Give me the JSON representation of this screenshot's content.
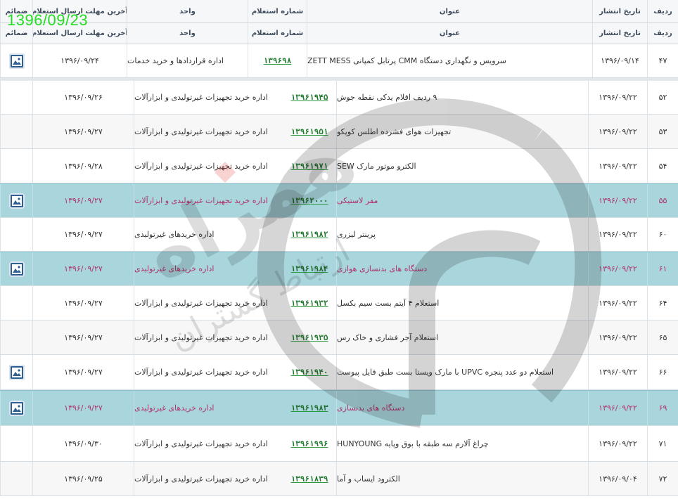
{
  "overlay_date": "1396/09/23",
  "headers": {
    "row_no": "ردیف",
    "pub_date": "تاریخ انتشار",
    "title": "عنوان",
    "inquiry_no": "شماره استعلام",
    "unit": "واحد",
    "deadline": "آخرین مهلت ارسال استعلام",
    "attachments": "ضمائم"
  },
  "top_row": {
    "no": "۴۷",
    "date": "۱۳۹۶/۰۹/۱۴",
    "title": "سرویس و نگهداری دستگاه CMM پرتابل کمپانی ZETT MESS",
    "inquiry": "۱۳۹۶۹۸",
    "unit": "اداره قراردادها و خرید خدمات",
    "deadline": "۱۳۹۶/۰۹/۲۴",
    "icon": "image-file-icon"
  },
  "rows": [
    {
      "no": "۵۲",
      "date": "۱۳۹۶/۰۹/۲۲",
      "title": "۹ ردیف اقلام یدکی نقطه جوش",
      "inquiry": "۱۳۹۶۱۹۴۵",
      "unit": "اداره خرید تجهیزات غیرتولیدی و ابزارآلات",
      "deadline": "۱۳۹۶/۰۹/۲۶",
      "style": "plain",
      "icon": false
    },
    {
      "no": "۵۳",
      "date": "۱۳۹۶/۰۹/۲۲",
      "title": "تجهیزات هوای فشرده اطلس کوپکو",
      "inquiry": "۱۳۹۶۱۹۵۱",
      "unit": "اداره خرید تجهیزات غیرتولیدی و ابزارآلات",
      "deadline": "۱۳۹۶/۰۹/۲۷",
      "style": "alt",
      "icon": false
    },
    {
      "no": "۵۴",
      "date": "۱۳۹۶/۰۹/۲۲",
      "title": "الکترو موتور مارک SEW",
      "inquiry": "۱۳۹۶۱۹۷۱",
      "unit": "اداره خرید تجهیزات غیرتولیدی و ابزارآلات",
      "deadline": "۱۳۹۶/۰۹/۲۸",
      "style": "plain",
      "icon": false
    },
    {
      "no": "۵۵",
      "date": "۱۳۹۶/۰۹/۲۲",
      "title": "مفر لاستیکی",
      "inquiry": "۱۳۹۶۲۰۰۰",
      "unit": "اداره خرید تجهیزات غیرتولیدی و ابزارآلات",
      "deadline": "۱۳۹۶/۰۹/۲۷",
      "style": "hl",
      "icon": true
    },
    {
      "no": "۶۰",
      "date": "۱۳۹۶/۰۹/۲۲",
      "title": "پرینتر لیزری",
      "inquiry": "۱۳۹۶۱۹۸۲",
      "unit": "اداره خریدهای غیرتولیدی",
      "deadline": "۱۳۹۶/۰۹/۲۷",
      "style": "plain",
      "icon": false
    },
    {
      "no": "۶۱",
      "date": "۱۳۹۶/۰۹/۲۲",
      "title": "دستگاه های بدنسازی هوازی",
      "inquiry": "۱۳۹۶۱۹۸۴",
      "unit": "اداره خریدهای غیرتولیدی",
      "deadline": "۱۳۹۶/۰۹/۲۷",
      "style": "hl",
      "icon": true
    },
    {
      "no": "۶۴",
      "date": "۱۳۹۶/۰۹/۲۲",
      "title": "استعلام ۴ آیتم بست سیم بکسل",
      "inquiry": "۱۳۹۶۱۹۳۲",
      "unit": "اداره خرید تجهیزات غیرتولیدی و ابزارآلات",
      "deadline": "۱۳۹۶/۰۹/۲۷",
      "style": "plain",
      "icon": false
    },
    {
      "no": "۶۵",
      "date": "۱۳۹۶/۰۹/۲۲",
      "title": "استعلام آجر فشاری و خاک رس",
      "inquiry": "۱۳۹۶۱۹۳۵",
      "unit": "اداره خرید تجهیزات غیرتولیدی و ابزارآلات",
      "deadline": "۱۳۹۶/۰۹/۲۷",
      "style": "alt",
      "icon": false
    },
    {
      "no": "۶۶",
      "date": "۱۳۹۶/۰۹/۲۲",
      "title": "استعلام دو عدد پنجره UPVC با مارک ویستا بست طبق فایل پیوست",
      "inquiry": "۱۳۹۶۱۹۴۰",
      "unit": "اداره خرید تجهیزات غیرتولیدی و ابزارآلات",
      "deadline": "۱۳۹۶/۰۹/۲۷",
      "style": "plain",
      "icon": true
    },
    {
      "no": "۶۹",
      "date": "۱۳۹۶/۰۹/۲۲",
      "title": "دستگاه های بدنسازی",
      "inquiry": "۱۳۹۶۱۹۸۳",
      "unit": "اداره خریدهای غیرتولیدی",
      "deadline": "۱۳۹۶/۰۹/۲۷",
      "style": "hl",
      "icon": true
    },
    {
      "no": "۷۱",
      "date": "۱۳۹۶/۰۹/۲۲",
      "title": "چراغ آلارم سه طبقه با بوق وپایه HUNYOUNG",
      "inquiry": "۱۳۹۶۱۹۹۶",
      "unit": "اداره خرید تجهیزات غیرتولیدی و ابزارآلات",
      "deadline": "۱۳۹۶/۰۹/۳۰",
      "style": "plain",
      "icon": false
    },
    {
      "no": "۷۲",
      "date": "۱۳۹۶/۰۹/۰۴",
      "title": "الکترود ایساب و آما",
      "inquiry": "۱۳۹۶۱۸۳۹",
      "unit": "اداره خرید تجهیزات غیرتولیدی و ابزارآلات",
      "deadline": "۱۳۹۶/۰۹/۲۵",
      "style": "alt",
      "icon": false
    }
  ],
  "watermark": {
    "brand_text": "همراه",
    "sub_text": "ارتباط گستران",
    "icon": "logo-watermark-icon"
  }
}
